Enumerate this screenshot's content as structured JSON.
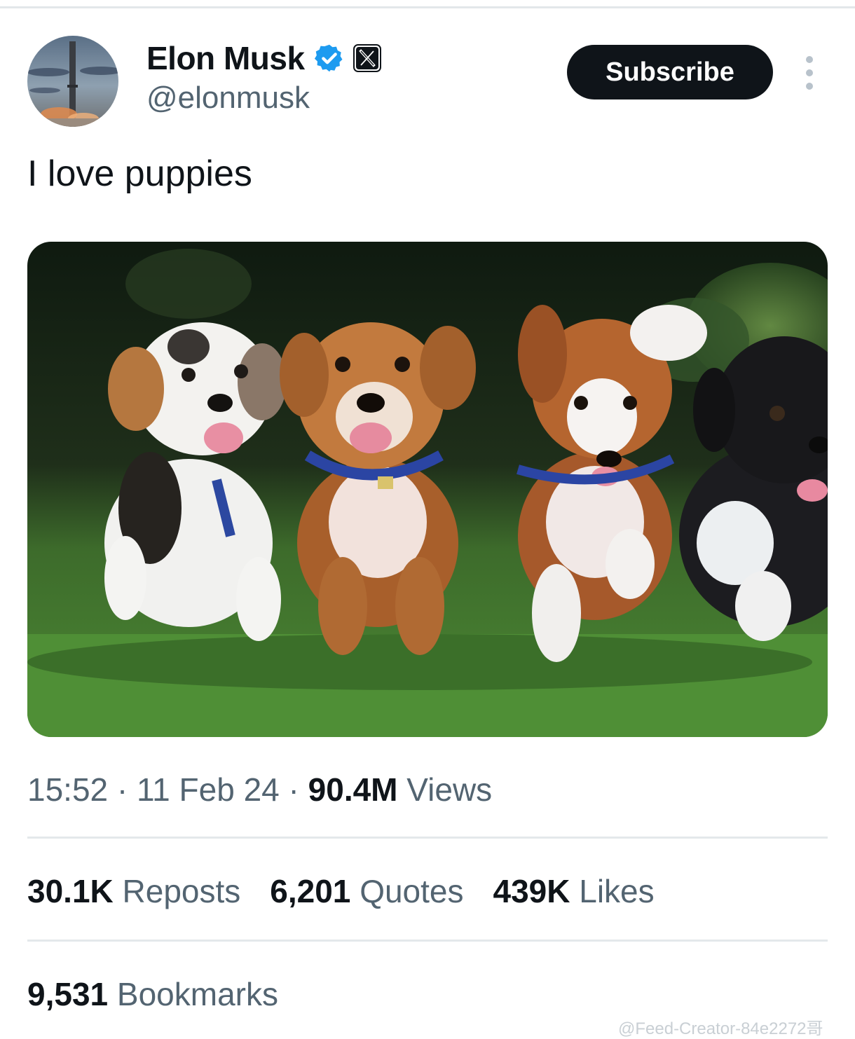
{
  "tweet": {
    "author": {
      "name": "Elon Musk",
      "handle": "@elonmusk",
      "verified_color": "#1d9bf0"
    },
    "subscribe_label": "Subscribe",
    "text": "I love puppies",
    "media": {
      "icon": "puppies-photo"
    },
    "meta": {
      "time": "15:52",
      "sep1": "·",
      "date": "11 Feb 24",
      "sep2": "·",
      "views_count": "90.4M",
      "views_label": "Views"
    },
    "stats": {
      "reposts": {
        "count": "30.1K",
        "label": "Reposts"
      },
      "quotes": {
        "count": "6,201",
        "label": "Quotes"
      },
      "likes": {
        "count": "439K",
        "label": "Likes"
      },
      "bookmarks": {
        "count": "9,531",
        "label": "Bookmarks"
      }
    }
  },
  "watermark": "@Feed-Creator-84e2272哥",
  "colors": {
    "text_primary": "#0f1419",
    "text_secondary": "#536471",
    "divider": "#e4e8eb",
    "button_bg": "#0f1419"
  }
}
